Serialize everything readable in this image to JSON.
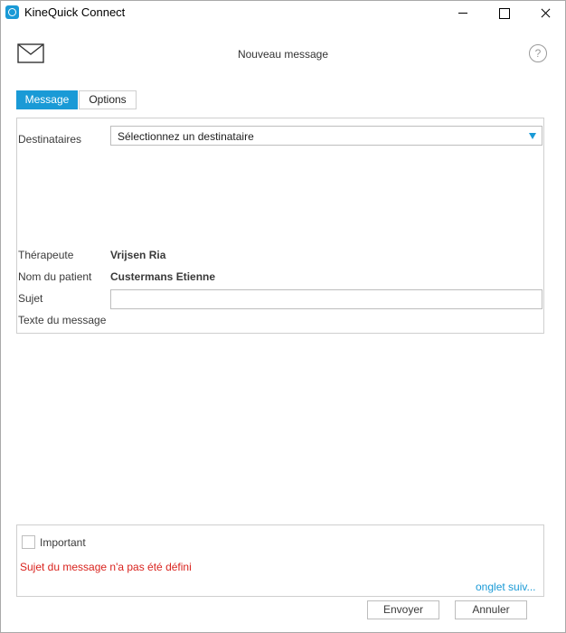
{
  "window": {
    "title": "KineQuick Connect"
  },
  "header": {
    "title": "Nouveau message",
    "help_symbol": "?"
  },
  "tabs": [
    {
      "label": "Message",
      "active": true
    },
    {
      "label": "Options",
      "active": false
    }
  ],
  "form": {
    "recipients_label": "Destinataires",
    "recipients_selected": "Sélectionnez un destinataire",
    "therapist_label": "Thérapeute",
    "therapist_value": "Vrijsen Ria",
    "patient_label": "Nom du patient",
    "patient_value": "Custermans Etienne",
    "subject_label": "Sujet",
    "subject_value": "",
    "message_label": "Texte du message",
    "message_value": "",
    "important_label": "Important",
    "important_checked": false,
    "error_message": "Sujet du message n'a pas été défini",
    "next_tab_link": "onglet suiv..."
  },
  "buttons": {
    "send": "Envoyer",
    "cancel": "Annuler"
  },
  "colors": {
    "accent": "#1a9ad6",
    "error": "#d9231e",
    "border": "#cfcfcf"
  },
  "icons": [
    "app-logo-icon",
    "minimize-icon",
    "maximize-icon",
    "close-icon",
    "envelope-icon",
    "help-icon",
    "dropdown-arrow-icon"
  ]
}
